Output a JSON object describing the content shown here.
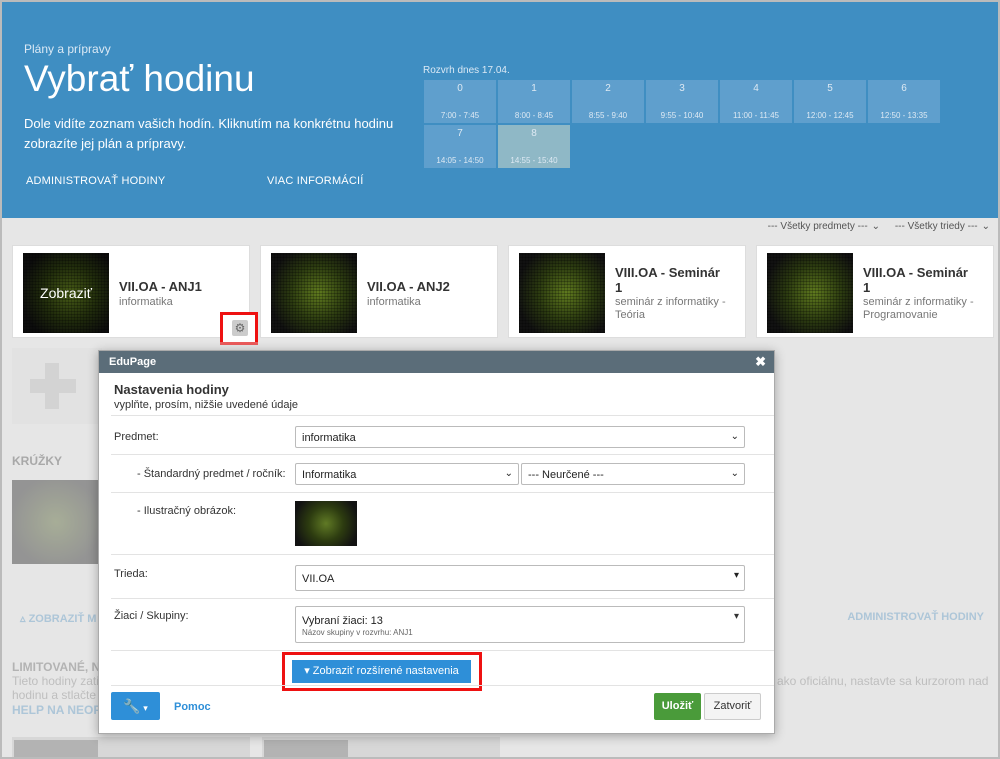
{
  "header": {
    "breadcrumb": "Plány a prípravy",
    "title": "Vybrať hodinu",
    "description": "Dole vidíte zoznam vašich hodín. Kliknutím na konkrétnu hodinu zobrazíte jej plán a prípravy.",
    "admin_link": "ADMINISTROVAŤ HODINY",
    "more_link": "VIAC INFORMÁCIÍ"
  },
  "rozvrh": {
    "title": "Rozvrh dnes 17.04.",
    "slots": [
      {
        "num": "0",
        "time": "7:00 - 7:45"
      },
      {
        "num": "1",
        "time": "8:00 - 8:45"
      },
      {
        "num": "2",
        "time": "8:55 - 9:40"
      },
      {
        "num": "3",
        "time": "9:55 - 10:40"
      },
      {
        "num": "4",
        "time": "11:00 - 11:45"
      },
      {
        "num": "5",
        "time": "12:00 - 12:45"
      },
      {
        "num": "6",
        "time": "12:50 - 13:35"
      },
      {
        "num": "7",
        "time": "14:05 - 14:50"
      },
      {
        "num": "8",
        "time": "14:55 - 15:40"
      }
    ],
    "active_slot": "8"
  },
  "filters": {
    "subjects": "--- Všetky predmety ---",
    "classes": "--- Všetky triedy ---"
  },
  "cards": [
    {
      "title": "VII.OA - ANJ1",
      "subtitle": "informatika",
      "overlay": "Zobraziť"
    },
    {
      "title": "VII.OA - ANJ2",
      "subtitle": "informatika"
    },
    {
      "title_l1": "VIII.OA - Seminár",
      "title_l2": "1",
      "sub_l1": "seminár z informatiky -",
      "sub_l2": "Teória"
    },
    {
      "title_l1": "VIII.OA - Seminár",
      "title_l2": "1",
      "sub_l1": "seminár z informatiky -",
      "sub_l2": "Programovanie"
    }
  ],
  "background": {
    "kruzky": "KRÚŽKY",
    "show_more": "ZOBRAZIŤ M",
    "admin_right": "ADMINISTROVAŤ HODINY",
    "limited_title": "LIMITOVANÉ, N",
    "limited_text1": "Tieto hodiny zati",
    "limited_text2": "hodinu a stlačte",
    "help_link": "HELP NA NEOF",
    "right_text": "ako oficiálnu, nastavte sa kurzorom nad"
  },
  "modal": {
    "app_title": "EduPage",
    "close_glyph": "✖",
    "title": "Nastavenia hodiny",
    "subtitle": "vyplňte, prosím, nižšie uvedené údaje",
    "predmet_label": "Predmet:",
    "predmet_value": "informatika",
    "std_label": "- Štandardný predmet / ročník:",
    "std_value": "Informatika",
    "rocnik_value": "--- Neurčené ---",
    "illus_label": "- Ilustračný obrázok:",
    "trieda_label": "Trieda:",
    "trieda_value": "VII.OA",
    "ziaci_label": "Žiaci / Skupiny:",
    "ziaci_value": "Vybraní žiaci: 13",
    "ziaci_sub": "Názov skupiny v rozvrhu: ANJ1",
    "advanced_button": "Zobraziť rozšírené nastavenia",
    "help_link": "Pomoc",
    "save_button": "Uložiť",
    "close_button": "Zatvoriť"
  },
  "colors": {
    "header_bg": "#3f8ec2",
    "primary_button": "#2e8fd8",
    "save_button": "#4a9b3a",
    "highlight_border": "#e11111"
  }
}
